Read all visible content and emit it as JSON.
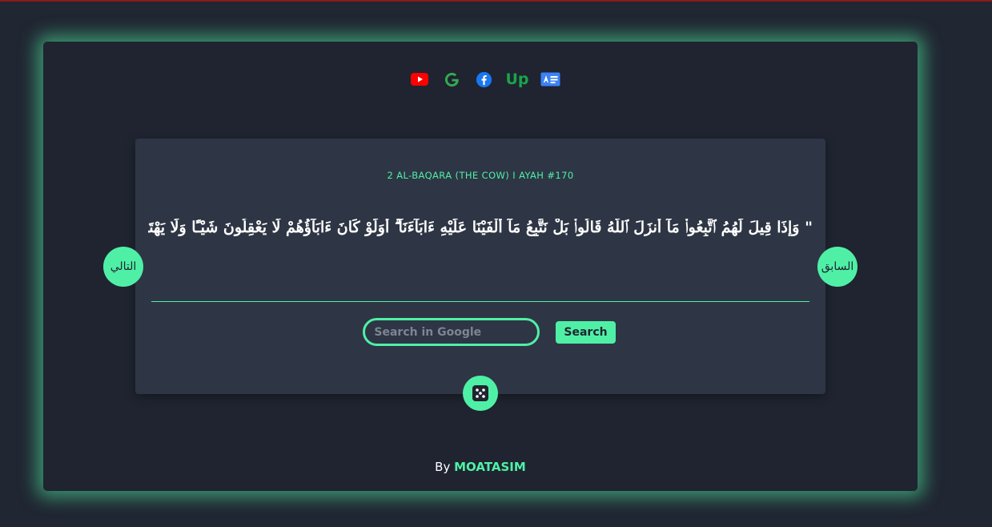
{
  "social_icons": [
    {
      "name": "youtube-icon",
      "color": "#ff0000"
    },
    {
      "name": "google-icon",
      "color": "#34a853"
    },
    {
      "name": "facebook-icon",
      "color": "#1877f2"
    },
    {
      "name": "upwork-icon",
      "label": "Up",
      "color": "#1aa34a"
    },
    {
      "name": "id-card-icon",
      "color": "#3b82f6"
    }
  ],
  "ayah": {
    "reference": "2 AL-BAQARA (THE COW) I AYAH #170",
    "text": "\" وَإِذَا قِيلَ لَهُمُ ٱتَّبِعُوا۟ مَآ أَنزَلَ ٱللَّهُ قَالُوا۟ بَلْ نَتَّبِعُ مَآ أَلْفَيْنَا عَلَيْهِ ءَابَآءَنَآ ۗ أَوَلَوْ كَانَ ءَابَآؤُهُمْ لَا يَعْقِلُونَ شَيْـًٔا وَلَا يَهْتَدُونَ \""
  },
  "nav": {
    "next_label": "التالي",
    "prev_label": "السابق"
  },
  "search": {
    "placeholder": "Search in Google",
    "value": "",
    "button_label": "Search"
  },
  "footer": {
    "by": "By",
    "author": "MOATASIM"
  },
  "colors": {
    "accent": "#4ff0a6",
    "background": "#202632",
    "card": "#2e3645"
  }
}
